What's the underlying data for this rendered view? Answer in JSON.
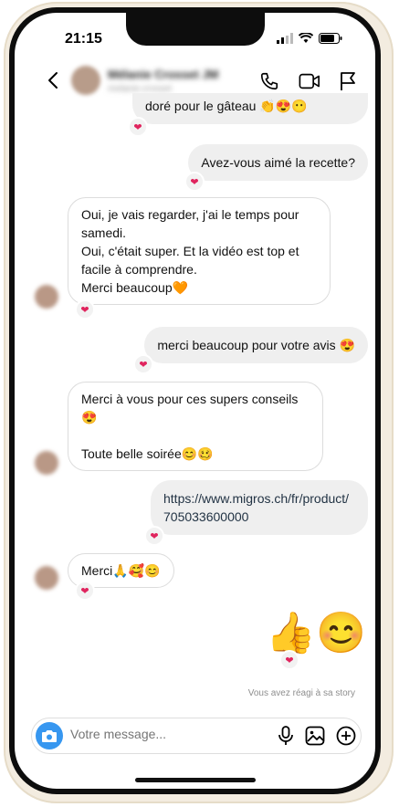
{
  "status_bar": {
    "time": "21:15"
  },
  "header": {
    "contact_name": "Mélanie Crosset JM",
    "contact_sub": "melanie.crosset"
  },
  "messages": [
    {
      "side": "out",
      "text": "doré pour le gâteau 👏😍😶",
      "reaction": "❤"
    },
    {
      "side": "out",
      "text": "Avez-vous aimé la recette?",
      "reaction": "❤"
    },
    {
      "side": "in",
      "lines": [
        "Oui, je vais regarder, j'ai le temps pour",
        "samedi.",
        "Oui, c'était super. Et la vidéo est top et",
        "facile à comprendre.",
        "Merci beaucoup🧡"
      ],
      "reaction": "❤"
    },
    {
      "side": "out",
      "text": "merci beaucoup pour votre avis 😍",
      "reaction": "❤"
    },
    {
      "side": "in",
      "lines": [
        "Merci à vous pour ces supers conseils",
        "😍",
        "",
        "Toute belle soirée😊🥴"
      ]
    },
    {
      "side": "out",
      "lines": [
        "https://www.migros.ch/fr/product/",
        "705033600000"
      ],
      "reaction": "❤"
    },
    {
      "side": "in",
      "text": "Merci🙏🥰😊",
      "reaction": "❤"
    },
    {
      "side": "out",
      "emoji": "👍😊",
      "reaction": "❤"
    }
  ],
  "story_note": "Vous avez réagi à sa story",
  "composer": {
    "placeholder": "Votre message..."
  },
  "icons": [
    "back-icon",
    "phone-icon",
    "video-icon",
    "flag-icon",
    "camera-icon",
    "microphone-icon",
    "image-icon",
    "plus-icon"
  ],
  "colors": {
    "accent": "#3797f0",
    "heart": "#e0245e",
    "bubble_out": "#efefef"
  }
}
